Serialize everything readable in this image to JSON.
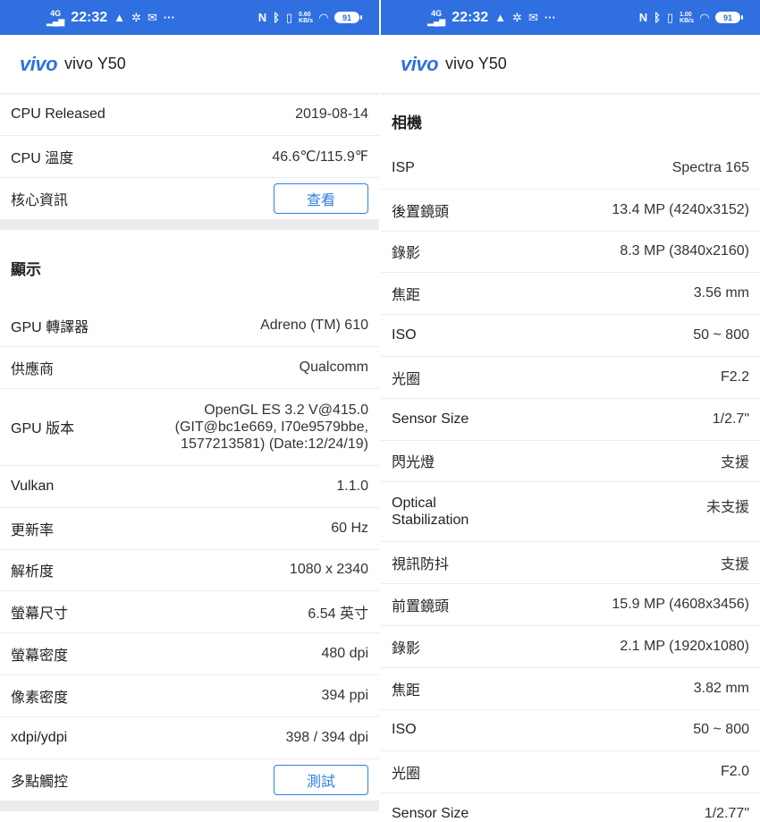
{
  "status": {
    "signal": "4G",
    "time": "22:32",
    "net_left": "0.60\nKB/s",
    "net_right": "1.00\nKB/s",
    "battery": "91"
  },
  "app": {
    "brand": "vivo",
    "device": "vivo Y50"
  },
  "left": {
    "top_rows": [
      {
        "k": "CPU Released",
        "v": "2019-08-14"
      },
      {
        "k": "CPU 溫度",
        "v": "46.6℃/115.9℉"
      }
    ],
    "core_info": {
      "k": "核心資訊",
      "btn": "查看"
    },
    "display_title": "顯示",
    "gpu_renderer": {
      "k": "GPU 轉譯器",
      "v": "Adreno (TM) 610"
    },
    "vendor": {
      "k": "供應商",
      "v": "Qualcomm"
    },
    "gpu_version": {
      "k": "GPU 版本",
      "v1": "OpenGL ES 3.2 V@415.0",
      "v2": "(GIT@bc1e669, I70e9579bbe,",
      "v3": "1577213581) (Date:12/24/19)"
    },
    "rows2": [
      {
        "k": "Vulkan",
        "v": "1.1.0"
      },
      {
        "k": "更新率",
        "v": "60 Hz"
      },
      {
        "k": "解析度",
        "v": "1080 x 2340"
      },
      {
        "k": "螢幕尺寸",
        "v": "6.54 英寸"
      },
      {
        "k": "螢幕密度",
        "v": "480 dpi"
      },
      {
        "k": "像素密度",
        "v": "394 ppi"
      },
      {
        "k": "xdpi/ydpi",
        "v": "398 / 394 dpi"
      }
    ],
    "multitouch": {
      "k": "多點觸控",
      "btn": "測試"
    }
  },
  "right": {
    "camera_title": "相機",
    "rows1": [
      {
        "k": "ISP",
        "v": "Spectra 165"
      },
      {
        "k": "後置鏡頭",
        "v": "13.4 MP (4240x3152)"
      },
      {
        "k": "錄影",
        "v": "8.3 MP (3840x2160)"
      },
      {
        "k": "焦距",
        "v": "3.56 mm"
      },
      {
        "k": "ISO",
        "v": "50 ~ 800"
      },
      {
        "k": "光圈",
        "v": "F2.2"
      },
      {
        "k": "Sensor Size",
        "v": "1/2.7\""
      },
      {
        "k": "閃光燈",
        "v": "支援"
      }
    ],
    "optical": {
      "k1": "Optical",
      "k2": "Stabilization",
      "v": "未支援"
    },
    "rows2": [
      {
        "k": "視訊防抖",
        "v": "支援"
      },
      {
        "k": "前置鏡頭",
        "v": "15.9 MP (4608x3456)"
      },
      {
        "k": "錄影",
        "v": "2.1 MP (1920x1080)"
      },
      {
        "k": "焦距",
        "v": "3.82 mm"
      },
      {
        "k": "ISO",
        "v": "50 ~ 800"
      },
      {
        "k": "光圈",
        "v": "F2.0"
      },
      {
        "k": "Sensor Size",
        "v": "1/2.77\""
      }
    ]
  }
}
